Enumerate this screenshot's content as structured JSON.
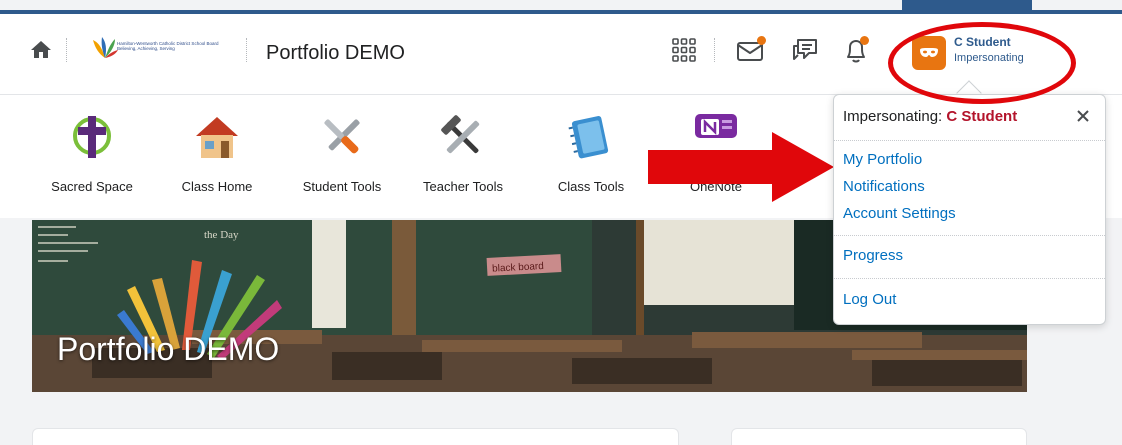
{
  "header": {
    "logo_text_line1": "Hamilton-Wentworth Catholic District School Board",
    "logo_text_line2": "Believing, Achieving, Serving",
    "course_title": "Portfolio DEMO",
    "icons": [
      "home-icon",
      "waffle-grid-icon",
      "mail-icon",
      "chat-icon",
      "bell-icon"
    ],
    "notification_color": "#e87511"
  },
  "user": {
    "name": "C Student",
    "status": "Impersonating",
    "avatar_color": "#e87511"
  },
  "nav": {
    "items": [
      {
        "label": "Sacred Space",
        "icon": "cross-icon"
      },
      {
        "label": "Class Home",
        "icon": "house-icon"
      },
      {
        "label": "Student Tools",
        "icon": "tools-icon"
      },
      {
        "label": "Teacher Tools",
        "icon": "hammer-wrench-icon"
      },
      {
        "label": "Class Tools",
        "icon": "notebook-icon"
      },
      {
        "label": "OneNote",
        "icon": "onenote-icon"
      }
    ]
  },
  "banner": {
    "title": "Portfolio DEMO",
    "sign_text": "black board",
    "chalk_text": "the Day"
  },
  "menu": {
    "header_prefix": "Impersonating: ",
    "header_name": "C Student",
    "items": [
      "My Portfolio",
      "Notifications",
      "Account Settings",
      "Progress",
      "Log Out"
    ],
    "link_color": "#006fbf"
  },
  "annotations": {
    "arrow_color": "#e0070b",
    "ellipse_color": "#e0070b"
  }
}
